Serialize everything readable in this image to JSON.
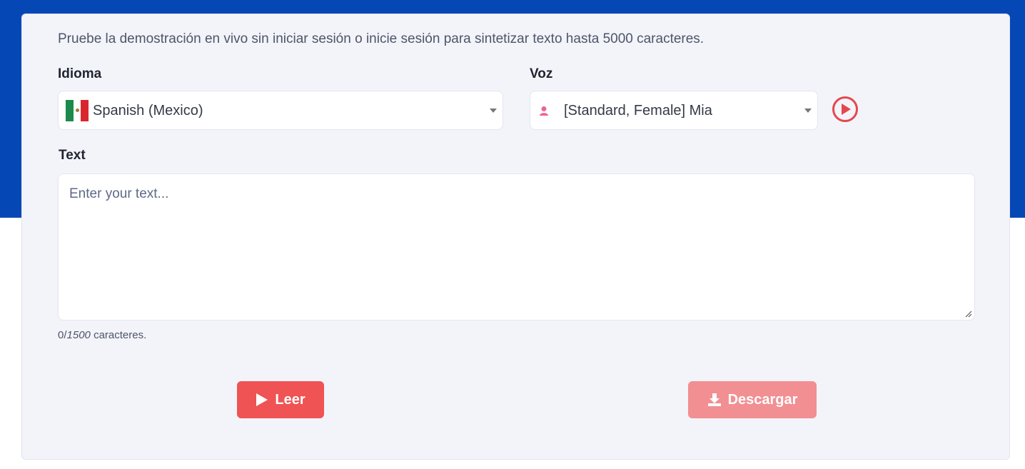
{
  "intro_text": "Pruebe la demostración en vivo sin iniciar sesión o inicie sesión para sintetizar texto hasta 5000 caracteres.",
  "language": {
    "label": "Idioma",
    "selected": "Spanish (Mexico)",
    "flag_icon": "mexico-flag-icon"
  },
  "voice": {
    "label": "Voz",
    "selected": "[Standard, Female] Mia",
    "icon": "female-user-icon",
    "preview_icon": "play-circle-icon"
  },
  "text": {
    "label": "Text",
    "placeholder": "Enter your text...",
    "value": ""
  },
  "counter": {
    "current": "0",
    "separator": "/",
    "max": "1500",
    "suffix": "caracteres."
  },
  "buttons": {
    "read_label": "Leer",
    "download_label": "Descargar"
  },
  "colors": {
    "brand_blue": "#0548b5",
    "accent_red": "#ef5353",
    "disabled_red": "#f28f92",
    "user_icon_pink": "#f06292"
  }
}
